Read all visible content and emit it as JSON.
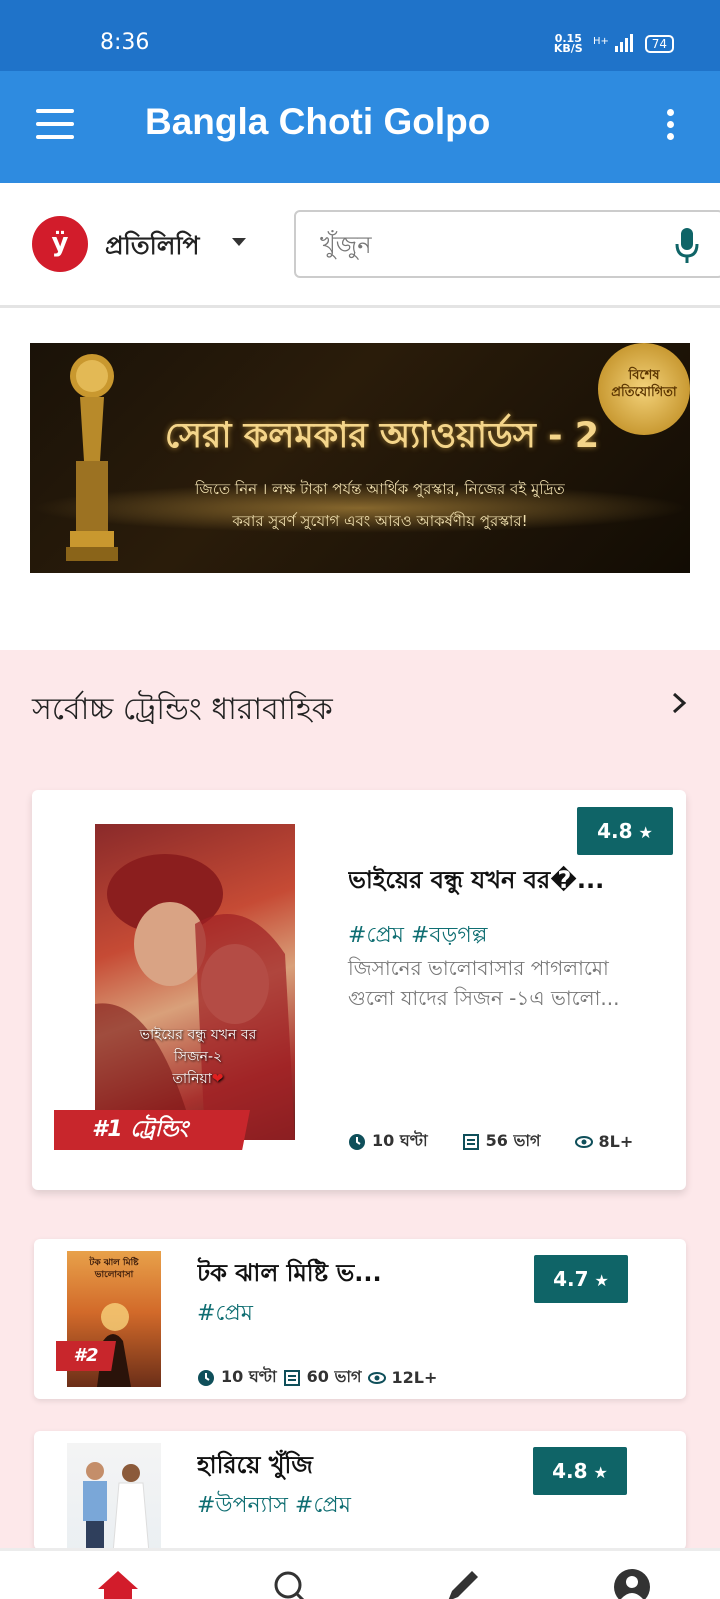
{
  "status_bar": {
    "time": "8:36",
    "net_speed_value": "0.15",
    "net_speed_unit": "KB/S",
    "signal": "H+",
    "battery": "74"
  },
  "app_bar": {
    "title": "Bangla Choti Golpo",
    "menu_icon": "hamburger-menu-icon",
    "overflow_icon": "more-vert-icon"
  },
  "brand": {
    "logo_letter": "ÿ",
    "name": "প্রতিলিপি",
    "caret_icon": "caret-down-icon"
  },
  "search": {
    "placeholder": "খুঁজুন",
    "value": "",
    "mic_icon": "mic-icon"
  },
  "banner": {
    "title": "সেরা কলমকার অ্যাওয়ার্ডস - 2",
    "subtitle_line1": "জিতে নিন । লক্ষ টাকা পর্যন্ত আর্থিক পুরস্কার, নিজের বই মুদ্রিত",
    "subtitle_line2": "করার সুবর্ণ সুযোগ এবং আরও আকর্ষণীয় পুরস্কার!",
    "seal_line1": "বিশেষ",
    "seal_line2": "প্রতিযোগিতা"
  },
  "trending": {
    "section_title": "সর্বোচ্চ ট্রেন্ডিং ধারাবাহিক",
    "featured": {
      "rating": "4.8",
      "title": "ভাইয়ের বন্ধু যখন বর�...",
      "tags": "#প্রেম #বড়গল্প",
      "description_line1": "জিসানের ভালোবাসার পাগলামো",
      "description_line2": "গুলো যাদের সিজন -১এ ভালো...",
      "rank_label": "#1 ট্রেন্ডিং",
      "cover_line1": "ভাইয়ের বন্ধু যখন বর",
      "cover_line2": "সিজন-২",
      "cover_line3": "তানিয়া",
      "read_time": "10 ঘণ্টা",
      "parts": "56 ভাগ",
      "reads": "8L+"
    },
    "items": [
      {
        "rank": "#2",
        "title": "টক ঝাল মিষ্টি ভ...",
        "tags": "#প্রেম",
        "rating": "4.7",
        "read_time": "10 ঘণ্টা",
        "parts": "60 ভাগ",
        "reads": "12L+",
        "cover_text_line1": "টক ঝাল মিষ্টি",
        "cover_text_line2": "ভালোবাসা"
      },
      {
        "rank": "",
        "title": "হারিয়ে খুঁজি",
        "tags": "#উপন্যাস #প্রেম",
        "rating": "4.8"
      }
    ]
  },
  "bottom_nav": {
    "items": [
      "home-icon",
      "search-icon",
      "write-icon",
      "profile-icon"
    ]
  },
  "colors": {
    "status_bar": "#1f73c9",
    "app_bar": "#2e8be0",
    "accent_teal": "#0f6467",
    "trending_bg": "#fde8ea",
    "rank_red": "#c8262c"
  }
}
